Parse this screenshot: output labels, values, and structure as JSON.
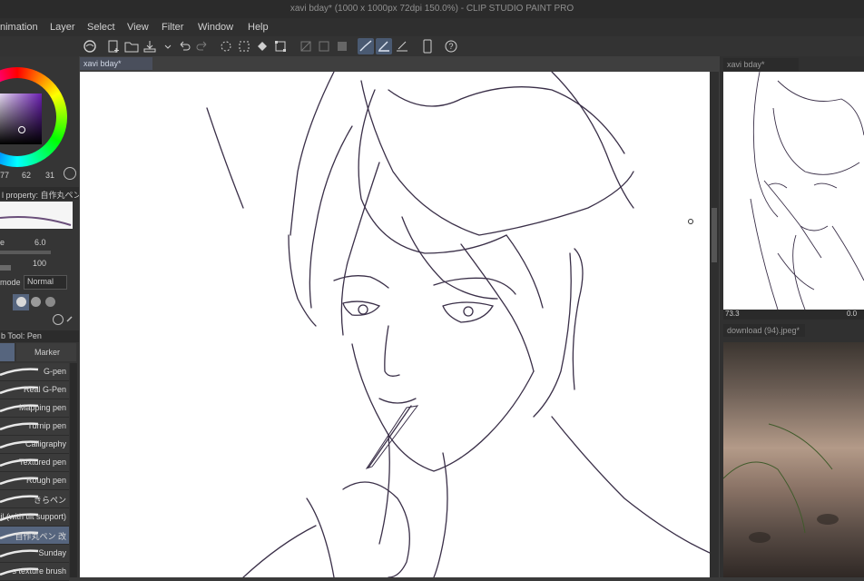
{
  "window": {
    "title": "xavi bday* (1000 x 1000px 72dpi 150.0%) - CLIP STUDIO PAINT PRO"
  },
  "menu": [
    "nimation",
    "Layer",
    "Select",
    "View",
    "Filter",
    "Window",
    "Help"
  ],
  "canvas_tab": {
    "label": "xavi bday*"
  },
  "left_panel": {
    "color_values": [
      "77",
      "62",
      "31"
    ],
    "tool_property_title": "l property: 自作丸ペン",
    "brush_size_label": "e",
    "brush_size_value": "6.0",
    "opacity_value": "100",
    "blend_mode_label": "mode",
    "blend_mode_value": "Normal",
    "subtool_title": "b Tool: Pen",
    "tab_marker": "Marker",
    "brushes": [
      {
        "label": "G-pen"
      },
      {
        "label": "Real G-Pen"
      },
      {
        "label": "Mapping pen"
      },
      {
        "label": "Turnip pen"
      },
      {
        "label": "Calligraphy"
      },
      {
        "label": "Textured pen"
      },
      {
        "label": "Rough pen"
      },
      {
        "label": "きらペン"
      },
      {
        "label": "cil (with tilt support)"
      },
      {
        "label": "自作丸ペン 改"
      },
      {
        "label": "Sunday"
      },
      {
        "label": "s texture brush"
      }
    ],
    "selected_brush_index": 9
  },
  "navigator": {
    "tab": "xavi bday*",
    "zoom": "73.3",
    "rotation": "0.0"
  },
  "reference": {
    "tab": "download (94).jpeg*"
  },
  "colors": {
    "accent": "#56657e",
    "panel": "#353535",
    "ink": "#3a2f48"
  }
}
